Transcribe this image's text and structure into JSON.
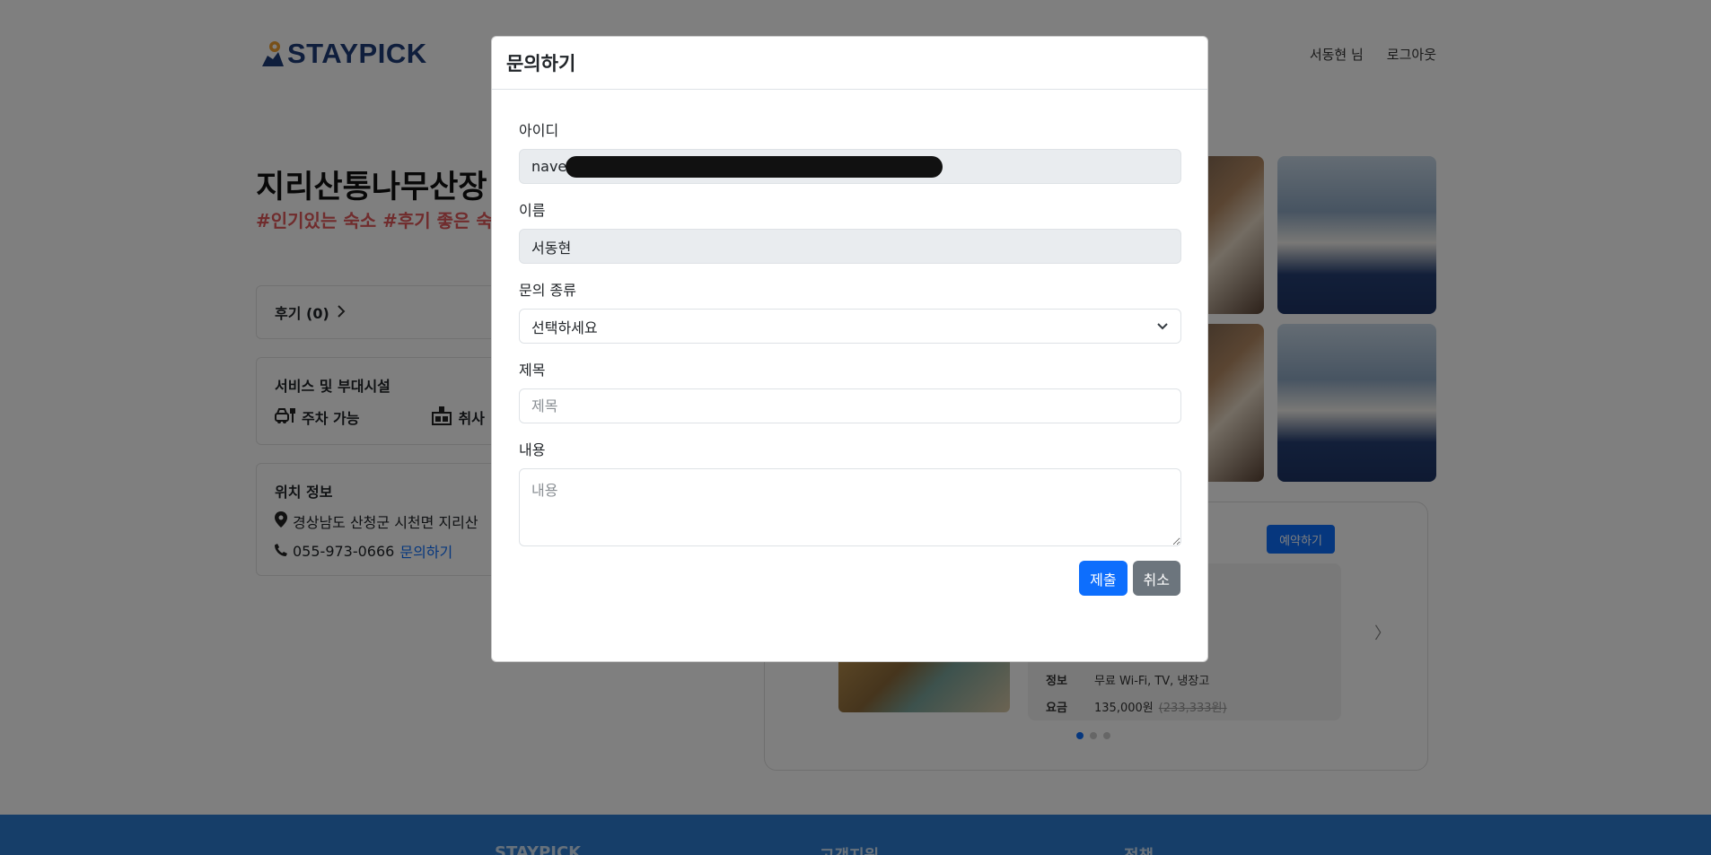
{
  "header": {
    "logo_text": "STAYPICK",
    "user_greeting": "서동현 님",
    "logout_label": "로그아웃"
  },
  "hotel": {
    "title": "지리산통나무산장",
    "tags": "#인기있는 숙소 #후기 좋은 숙"
  },
  "review_card": {
    "label": "후기 (0)"
  },
  "services_card": {
    "heading": "서비스 및 부대시설",
    "items": [
      "주차 가능",
      "취사 :"
    ]
  },
  "location_card": {
    "heading": "위치 정보",
    "address": "경상남도 산청군 시천면 지리산",
    "phone": "055-973-0666",
    "inquiry_link": "문의하기"
  },
  "room": {
    "book_label": "예약하기",
    "info_label": "정보",
    "info_value": "무료 Wi-Fi, TV, 냉장고",
    "price_label": "요금",
    "price_value": "135,000원",
    "price_original": "(233,333원)"
  },
  "footer": {
    "col1": "STAYPICK",
    "col2": "고객지원",
    "col3": "정책"
  },
  "modal": {
    "title": "문의하기",
    "id_label": "아이디",
    "id_value": "naver",
    "name_label": "이름",
    "name_value": "서동현",
    "type_label": "문의 종류",
    "type_selected": "선택하세요",
    "subject_label": "제목",
    "subject_placeholder": "제목",
    "content_label": "내용",
    "content_placeholder": "내용",
    "submit_label": "제출",
    "cancel_label": "취소"
  },
  "colors": {
    "brand": "#1f3c78",
    "primary": "#0d6efd",
    "secondary": "#6c757d",
    "tag_red": "#e0585a",
    "footer_blue": "#2d7dd2"
  }
}
